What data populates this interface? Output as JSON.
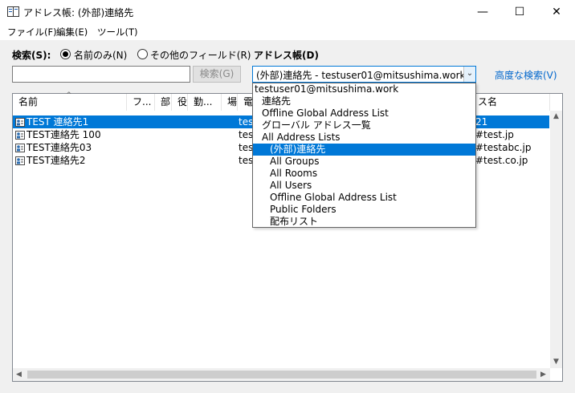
{
  "window": {
    "title": "アドレス帳: (外部)連絡先",
    "controls": {
      "minimize": "—",
      "maximize": "☐",
      "close": "✕"
    }
  },
  "menu": {
    "file": "ファイル(F)",
    "edit": "編集(E)",
    "tools": "ツール(T)"
  },
  "search": {
    "label": "検索(S):",
    "option_name_only": "名前のみ(N)",
    "option_other_fields": "その他のフィールド(R)",
    "selected_option": "name_only",
    "input_value": "",
    "button": "検索(G)"
  },
  "address_book": {
    "label": "アドレス帳(D)",
    "current": "(外部)連絡先 - testuser01@mitsushima.work",
    "advanced_search": "高度な検索(V)",
    "dropdown_items": [
      "testuser01@mitsushima.work",
      "連絡先",
      "Offline Global Address List",
      "グローバル アドレス一覧",
      "All Address Lists",
      "(外部)連絡先",
      "All Groups",
      "All Rooms",
      "All Users",
      "Offline Global Address List",
      "Public Folders",
      "配布リスト"
    ],
    "selected_index": 5
  },
  "list": {
    "columns": [
      "名前",
      "フ...",
      "部",
      "役",
      "勤...",
      "場",
      "電",
      "ス名"
    ],
    "rows": [
      {
        "name": "TEST 連絡先1",
        "col2": "tes",
        "email": "21"
      },
      {
        "name": "TEST連絡先 100",
        "col2": "tes",
        "email": "#test.jp"
      },
      {
        "name": "TEST連絡先03",
        "col2": "tes",
        "email": "#testabc.jp"
      },
      {
        "name": "TEST連絡先2",
        "col2": "tes",
        "email": "#test.co.jp"
      }
    ],
    "selected_row": 0
  },
  "colors": {
    "accent": "#0078d7",
    "link": "#0066cc"
  },
  "icons": {
    "app": "address-book-icon",
    "contact": "contact-card-icon"
  }
}
